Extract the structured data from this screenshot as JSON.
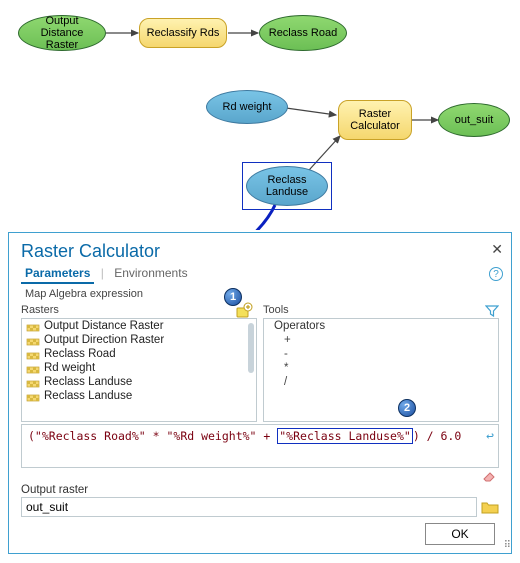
{
  "flow": {
    "output_distance": "Output Distance Raster",
    "reclassify_rds": "Reclassify Rds",
    "reclass_road": "Reclass Road",
    "rd_weight": "Rd weight",
    "raster_calc": "Raster Calculator",
    "out_suit": "out_suit",
    "reclass_landuse": "Reclass Landuse"
  },
  "panel": {
    "title": "Raster Calculator",
    "tab_params": "Parameters",
    "tab_env": "Environments",
    "section": "Map Algebra expression",
    "rasters_label": "Rasters",
    "tools_label": "Tools",
    "operators_label": "Operators",
    "rasters": [
      "Output Distance Raster",
      "Output Direction Raster",
      "Reclass Road",
      "Rd weight",
      "Reclass Landuse",
      "Reclass Landuse"
    ],
    "operators": [
      "+",
      "-",
      "*",
      "/"
    ],
    "expr_prefix": "(\"%Reclass Road%\"  *  \"%Rd weight%\" + ",
    "expr_hl": "\"%Reclass Landuse%\"",
    "expr_suffix": ") / 6.0",
    "output_label": "Output raster",
    "output_value": "out_suit",
    "ok_label": "OK"
  },
  "badges": {
    "one": "1",
    "two": "2"
  }
}
